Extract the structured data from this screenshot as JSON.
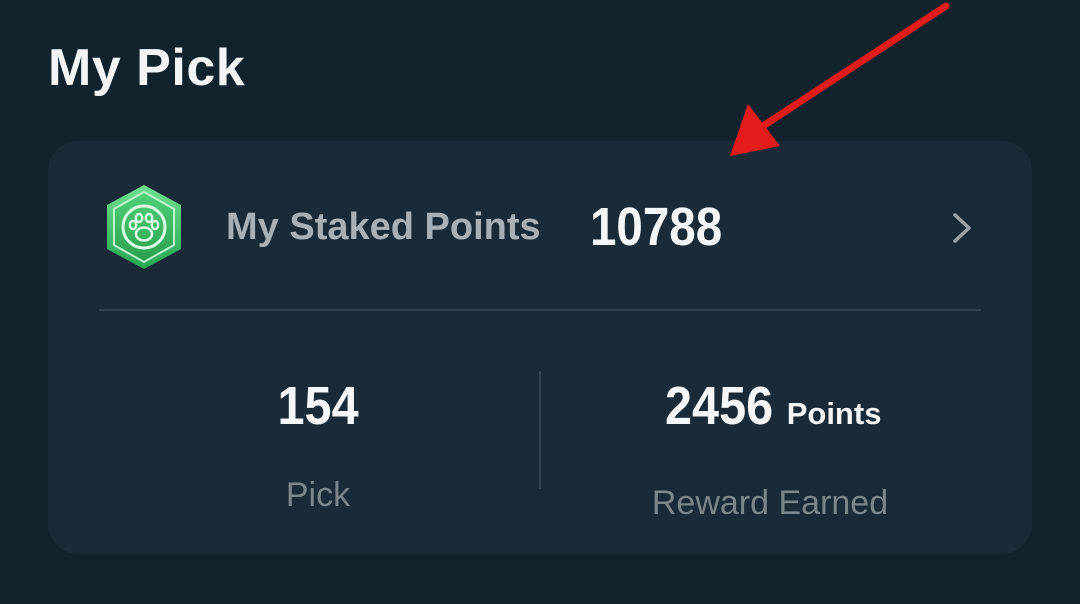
{
  "section": {
    "title": "My Pick"
  },
  "staked": {
    "label": "My Staked Points",
    "value": "10788",
    "badge_icon": "paw-badge-icon",
    "chevron_icon": "chevron-right-icon"
  },
  "stats": {
    "pick": {
      "value": "154",
      "label": "Pick"
    },
    "reward": {
      "value": "2456",
      "unit": "Points",
      "label": "Reward Earned"
    }
  },
  "annotation": {
    "icon": "red-arrow-icon",
    "color": "#e41b1b"
  },
  "colors": {
    "background": "#12222d",
    "card": "#1a2b37",
    "badge_green": "#3fc46a"
  }
}
